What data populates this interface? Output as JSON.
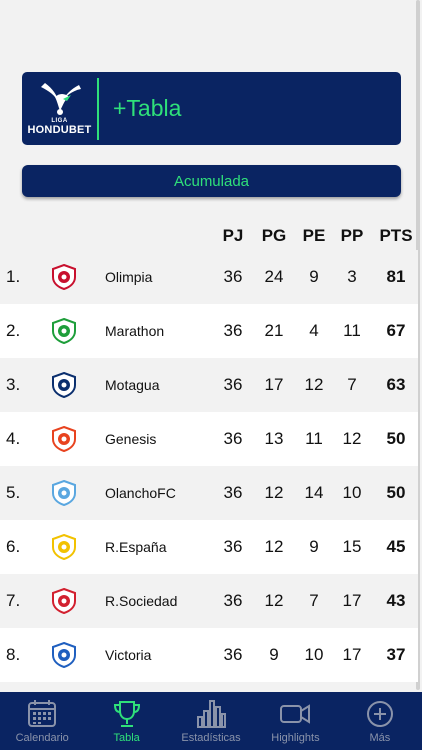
{
  "banner": {
    "logo_top": "LIGA",
    "logo_brand": "HONDUBET",
    "title": "+Tabla"
  },
  "mode_button": "Acumulada",
  "columns": [
    "PJ",
    "PG",
    "PE",
    "PP",
    "PTS"
  ],
  "rows": [
    {
      "rank": "1.",
      "team": "Olimpia",
      "pj": "36",
      "pg": "24",
      "pe": "9",
      "pp": "3",
      "pts": "81",
      "crest_color": "#c8102e"
    },
    {
      "rank": "2.",
      "team": "Marathon",
      "pj": "36",
      "pg": "21",
      "pe": "4",
      "pp": "11",
      "pts": "67",
      "crest_color": "#1e9e3a"
    },
    {
      "rank": "3.",
      "team": "Motagua",
      "pj": "36",
      "pg": "17",
      "pe": "12",
      "pp": "7",
      "pts": "63",
      "crest_color": "#0b2f6e"
    },
    {
      "rank": "4.",
      "team": "Genesis",
      "pj": "36",
      "pg": "13",
      "pe": "11",
      "pp": "12",
      "pts": "50",
      "crest_color": "#e8431f"
    },
    {
      "rank": "5.",
      "team": "OlanchoFC",
      "pj": "36",
      "pg": "12",
      "pe": "14",
      "pp": "10",
      "pts": "50",
      "crest_color": "#5aa7e0"
    },
    {
      "rank": "6.",
      "team": "R.España",
      "pj": "36",
      "pg": "12",
      "pe": "9",
      "pp": "15",
      "pts": "45",
      "crest_color": "#f2c200"
    },
    {
      "rank": "7.",
      "team": "R.Sociedad",
      "pj": "36",
      "pg": "12",
      "pe": "7",
      "pp": "17",
      "pts": "43",
      "crest_color": "#d2202f"
    },
    {
      "rank": "8.",
      "team": "Victoria",
      "pj": "36",
      "pg": "9",
      "pe": "10",
      "pp": "17",
      "pts": "37",
      "crest_color": "#1f5fbf"
    }
  ],
  "nav": [
    {
      "label": "Calendario",
      "icon": "calendar-icon",
      "active": false
    },
    {
      "label": "Tabla",
      "icon": "trophy-icon",
      "active": true
    },
    {
      "label": "Estadísticas",
      "icon": "bar-chart-icon",
      "active": false
    },
    {
      "label": "Highlights",
      "icon": "video-camera-icon",
      "active": false
    },
    {
      "label": "Más",
      "icon": "plus-circle-icon",
      "active": false
    }
  ],
  "colors": {
    "navy": "#0a2462",
    "accent_green": "#2fe07a",
    "nav_inactive": "#8a93aa"
  }
}
